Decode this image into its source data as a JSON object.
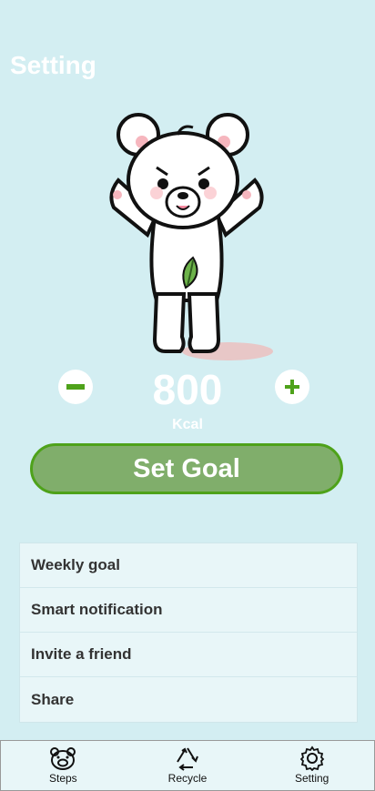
{
  "header": {
    "title": "Setting"
  },
  "goal": {
    "value": "800",
    "unit": "Kcal"
  },
  "icons": {
    "minus": "minus-icon",
    "plus": "plus-icon",
    "bear": "bear-mascot"
  },
  "colors": {
    "accent_green": "#4ea21a",
    "button_fill": "#80ae6b",
    "background": "#d3eef2"
  },
  "actions": {
    "set_goal_label": "Set Goal"
  },
  "menu": {
    "items": [
      {
        "label": "Weekly goal"
      },
      {
        "label": "Smart notification"
      },
      {
        "label": "Invite a friend"
      },
      {
        "label": "Share"
      }
    ]
  },
  "tabbar": {
    "tabs": [
      {
        "label": "Steps",
        "icon": "pig-icon"
      },
      {
        "label": "Recycle",
        "icon": "recycle-icon"
      },
      {
        "label": "Setting",
        "icon": "gear-icon"
      }
    ]
  }
}
